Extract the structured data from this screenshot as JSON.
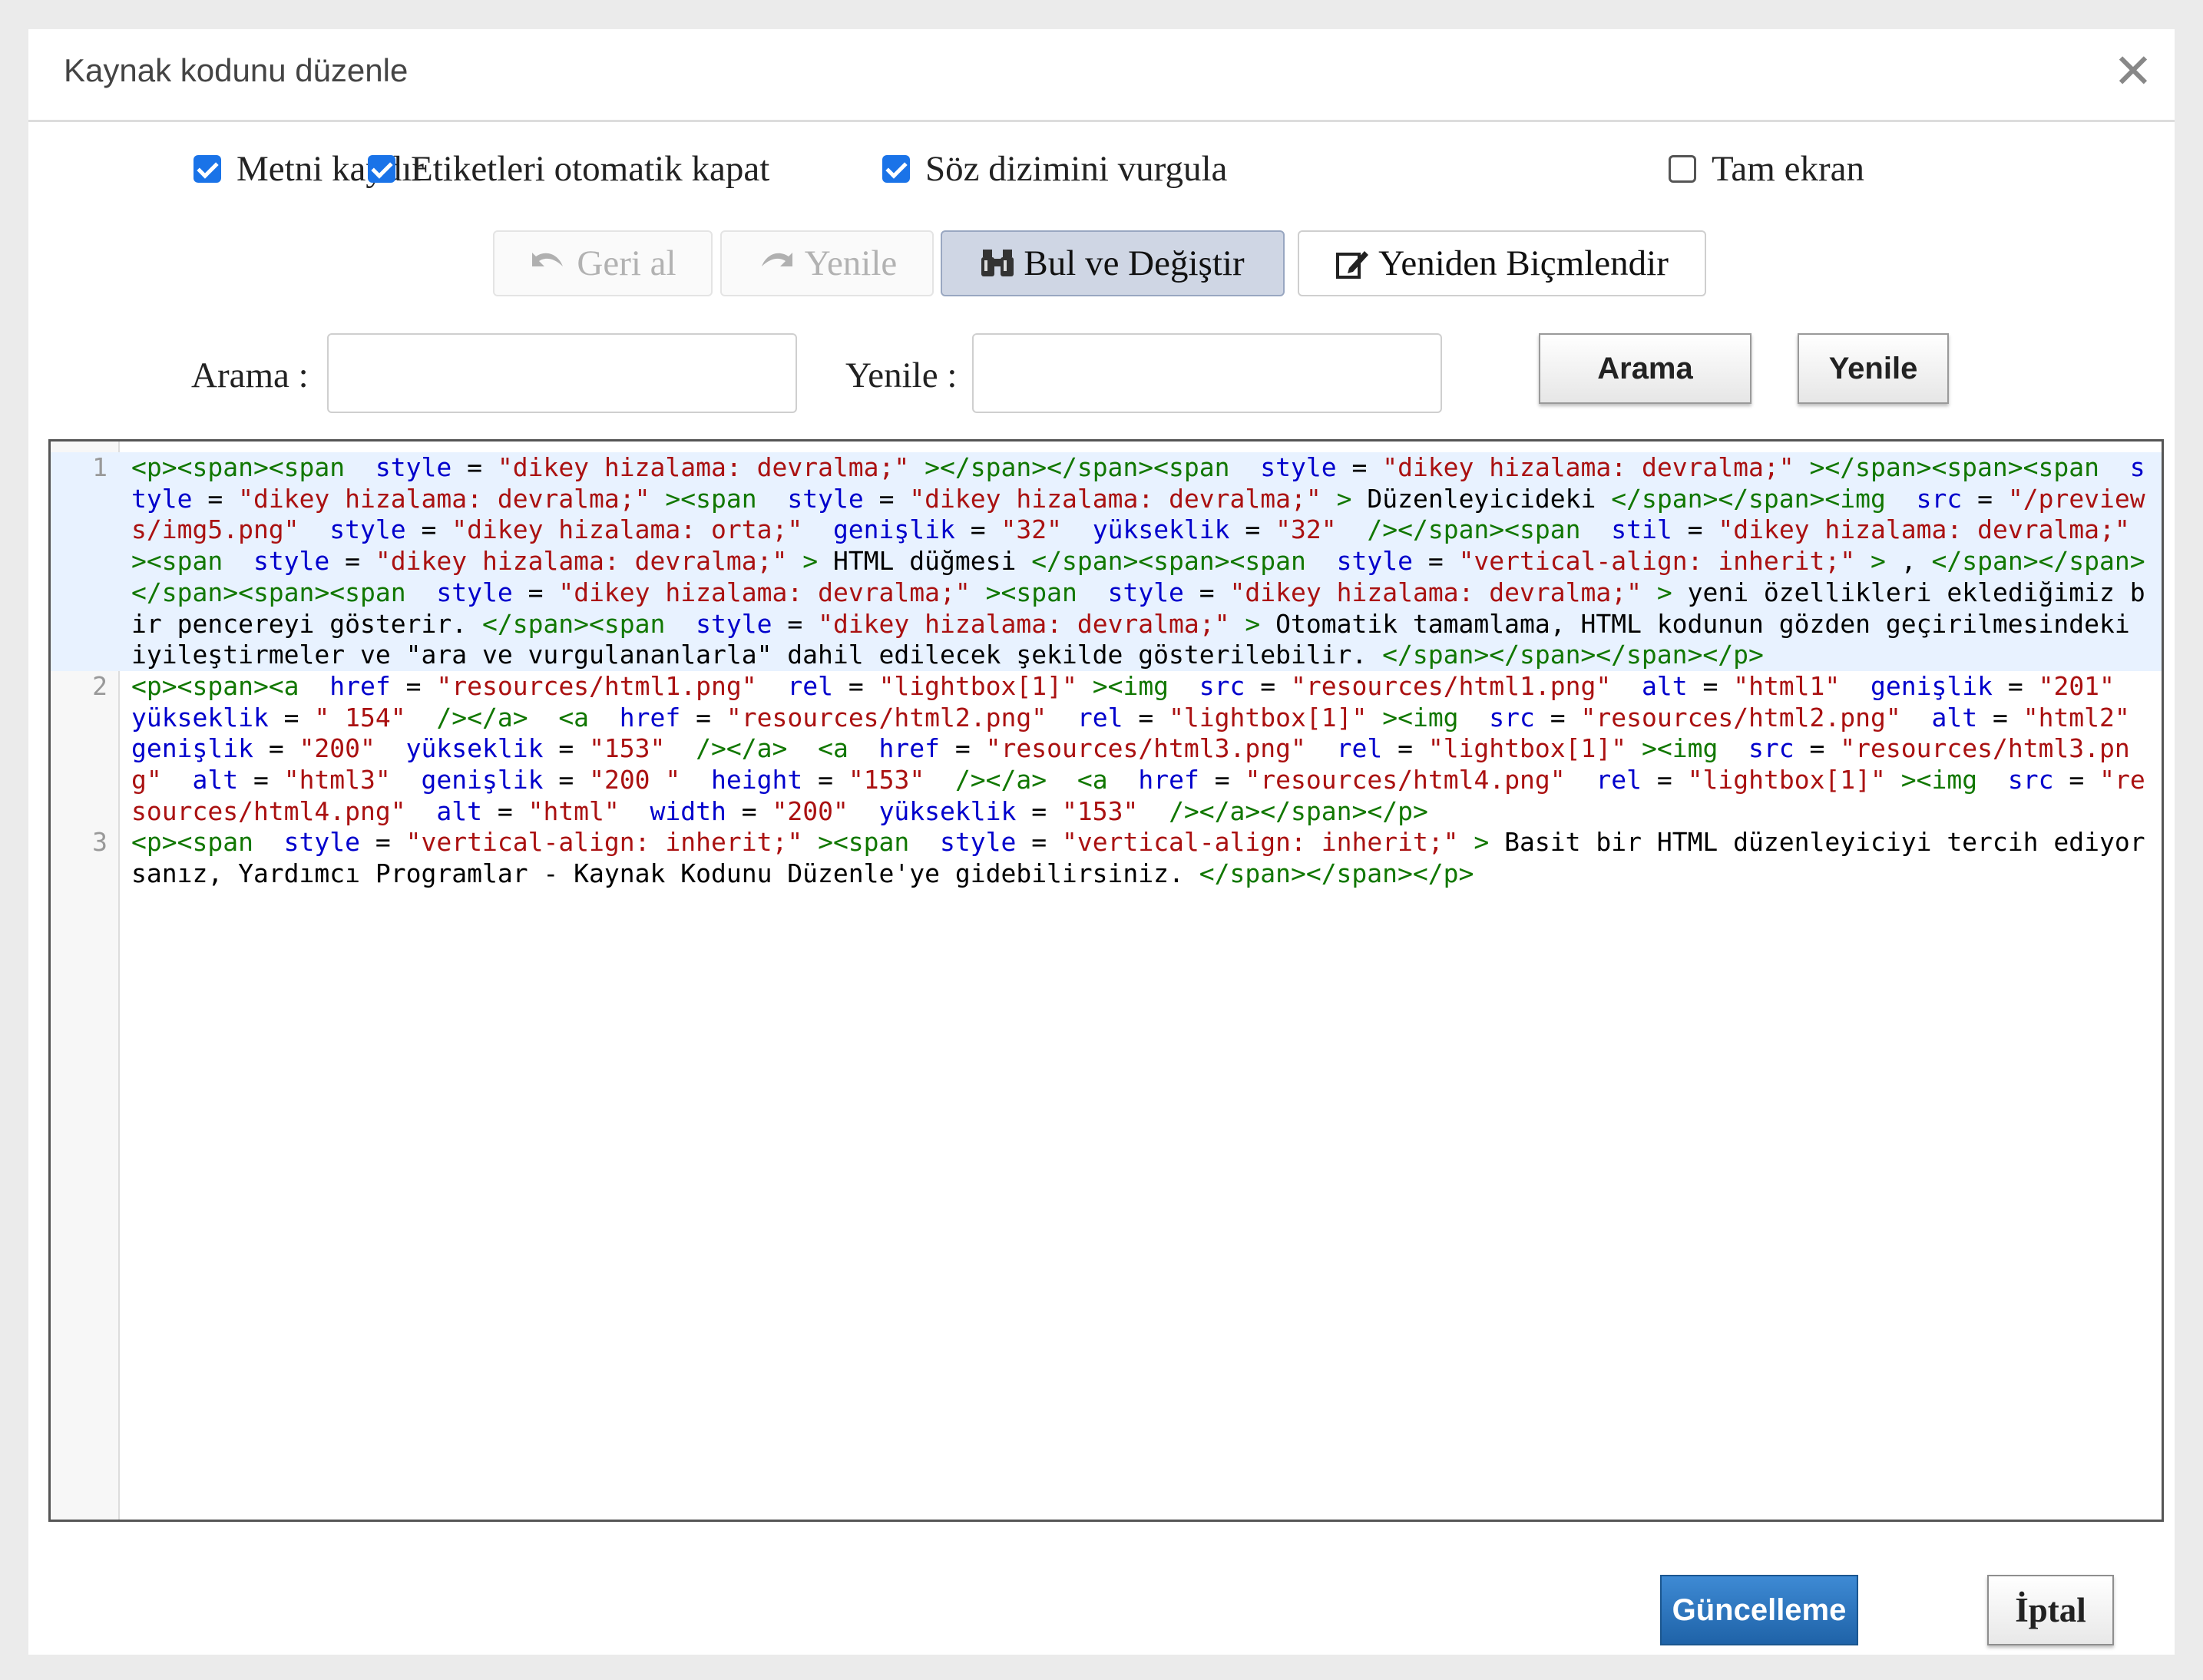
{
  "dialog": {
    "title": "Kaynak kodunu düzenle",
    "close_glyph": "✕"
  },
  "options": [
    {
      "label": "Metni kaydır",
      "checked": true
    },
    {
      "label": "Etiketleri otomatik kapat",
      "checked": true
    },
    {
      "label": "Söz dizimini vurgula",
      "checked": true
    },
    {
      "label": "Tam ekran",
      "checked": false
    }
  ],
  "toolbar": {
    "undo_label": "Geri al",
    "redo_label": "Yenile",
    "find_replace_label": "Bul ve Değiştir",
    "reformat_label": "Yeniden Biçmlendir"
  },
  "search": {
    "search_label": "Arama :",
    "replace_label": "Yenile :",
    "search_value": "",
    "replace_value": "",
    "search_button": "Arama",
    "replace_button": "Yenile"
  },
  "editor": {
    "lines": [
      {
        "number": "1",
        "selected": true,
        "tokens": [
          {
            "k": "t",
            "v": "<p><span><span "
          },
          {
            "k": "a",
            "v": " style"
          },
          {
            "k": "x",
            "v": " = "
          },
          {
            "k": "s",
            "v": "\"dikey hizalama: devralma;\""
          },
          {
            "k": "t",
            "v": " ></span></span><span "
          },
          {
            "k": "a",
            "v": " style"
          },
          {
            "k": "x",
            "v": " = "
          },
          {
            "k": "s",
            "v": "\"dikey hizalama: devralma;\""
          },
          {
            "k": "t",
            "v": " ></span><span><span "
          },
          {
            "k": "a",
            "v": " style"
          },
          {
            "k": "x",
            "v": " = "
          },
          {
            "k": "s",
            "v": "\"dikey hizalama: devralma;\""
          },
          {
            "k": "t",
            "v": " ><span "
          },
          {
            "k": "a",
            "v": " style"
          },
          {
            "k": "x",
            "v": " = "
          },
          {
            "k": "s",
            "v": "\"dikey hizalama: devralma;\""
          },
          {
            "k": "t",
            "v": " > "
          },
          {
            "k": "x",
            "v": "Düzenleyicideki "
          },
          {
            "k": "t",
            "v": "</span></span><img "
          },
          {
            "k": "a",
            "v": " src"
          },
          {
            "k": "x",
            "v": " = "
          },
          {
            "k": "s",
            "v": "\"/previews/img5.png\""
          },
          {
            "k": "a",
            "v": "  style"
          },
          {
            "k": "x",
            "v": " = "
          },
          {
            "k": "s",
            "v": "\"dikey hizalama: orta;\""
          },
          {
            "k": "a",
            "v": "  genişlik"
          },
          {
            "k": "x",
            "v": " = "
          },
          {
            "k": "s",
            "v": "\"32\""
          },
          {
            "k": "a",
            "v": "  yükseklik"
          },
          {
            "k": "x",
            "v": " = "
          },
          {
            "k": "s",
            "v": "\"32\""
          },
          {
            "k": "t",
            "v": "  /></span><span "
          },
          {
            "k": "a",
            "v": " stil"
          },
          {
            "k": "x",
            "v": " = "
          },
          {
            "k": "s",
            "v": "\"dikey hizalama: devralma;\""
          },
          {
            "k": "t",
            "v": " ><span "
          },
          {
            "k": "a",
            "v": " style"
          },
          {
            "k": "x",
            "v": " = "
          },
          {
            "k": "s",
            "v": "\"dikey hizalama: devralma;\""
          },
          {
            "k": "t",
            "v": " > "
          },
          {
            "k": "x",
            "v": "HTML düğmesi "
          },
          {
            "k": "t",
            "v": "</span><span><span "
          },
          {
            "k": "a",
            "v": " style"
          },
          {
            "k": "x",
            "v": " = "
          },
          {
            "k": "s",
            "v": "\"vertical-align: inherit;\""
          },
          {
            "k": "t",
            "v": " > "
          },
          {
            "k": "x",
            "v": ", "
          },
          {
            "k": "t",
            "v": "</span></span></span><span><span "
          },
          {
            "k": "a",
            "v": " style"
          },
          {
            "k": "x",
            "v": " = "
          },
          {
            "k": "s",
            "v": "\"dikey hizalama: devralma;\""
          },
          {
            "k": "t",
            "v": " ><span "
          },
          {
            "k": "a",
            "v": " style"
          },
          {
            "k": "x",
            "v": " = "
          },
          {
            "k": "s",
            "v": "\"dikey hizalama: devralma;\""
          },
          {
            "k": "t",
            "v": " > "
          },
          {
            "k": "x",
            "v": "yeni özellikleri eklediğimiz bir pencereyi gösterir. "
          },
          {
            "k": "t",
            "v": "</span><span "
          },
          {
            "k": "a",
            "v": " style"
          },
          {
            "k": "x",
            "v": " = "
          },
          {
            "k": "s",
            "v": "\"dikey hizalama: devralma;\""
          },
          {
            "k": "t",
            "v": " > "
          },
          {
            "k": "x",
            "v": "Otomatik tamamlama, HTML kodunun gözden geçirilmesindeki iyileştirmeler ve \"ara ve vurgulananlarla\" dahil edilecek şekilde gösterilebilir. "
          },
          {
            "k": "t",
            "v": "</span></span></span></p>"
          }
        ]
      },
      {
        "number": "2",
        "selected": false,
        "tokens": [
          {
            "k": "t",
            "v": "<p><span><a "
          },
          {
            "k": "a",
            "v": " href"
          },
          {
            "k": "x",
            "v": " = "
          },
          {
            "k": "s",
            "v": "\"resources/html1.png\""
          },
          {
            "k": "a",
            "v": "  rel"
          },
          {
            "k": "x",
            "v": " = "
          },
          {
            "k": "s",
            "v": "\"lightbox[1]\""
          },
          {
            "k": "t",
            "v": " ><img "
          },
          {
            "k": "a",
            "v": " src"
          },
          {
            "k": "x",
            "v": " = "
          },
          {
            "k": "s",
            "v": "\"resources/html1.png\""
          },
          {
            "k": "a",
            "v": "  alt"
          },
          {
            "k": "x",
            "v": " = "
          },
          {
            "k": "s",
            "v": "\"html1\""
          },
          {
            "k": "a",
            "v": "  genişlik"
          },
          {
            "k": "x",
            "v": " = "
          },
          {
            "k": "s",
            "v": "\"201\""
          },
          {
            "k": "a",
            "v": "  yükseklik"
          },
          {
            "k": "x",
            "v": " = "
          },
          {
            "k": "s",
            "v": "\" 154\""
          },
          {
            "k": "t",
            "v": "  /></a>  <a "
          },
          {
            "k": "a",
            "v": " href"
          },
          {
            "k": "x",
            "v": " = "
          },
          {
            "k": "s",
            "v": "\"resources/html2.png\""
          },
          {
            "k": "a",
            "v": "  rel"
          },
          {
            "k": "x",
            "v": " = "
          },
          {
            "k": "s",
            "v": "\"lightbox[1]\""
          },
          {
            "k": "t",
            "v": " ><img "
          },
          {
            "k": "a",
            "v": " src"
          },
          {
            "k": "x",
            "v": " = "
          },
          {
            "k": "s",
            "v": "\"resources/html2.png\""
          },
          {
            "k": "a",
            "v": "  alt"
          },
          {
            "k": "x",
            "v": " = "
          },
          {
            "k": "s",
            "v": "\"html2\""
          },
          {
            "k": "a",
            "v": "  genişlik"
          },
          {
            "k": "x",
            "v": " = "
          },
          {
            "k": "s",
            "v": "\"200\""
          },
          {
            "k": "a",
            "v": "  yükseklik"
          },
          {
            "k": "x",
            "v": " = "
          },
          {
            "k": "s",
            "v": "\"153\""
          },
          {
            "k": "t",
            "v": "  /></a>  <a "
          },
          {
            "k": "a",
            "v": " href"
          },
          {
            "k": "x",
            "v": " = "
          },
          {
            "k": "s",
            "v": "\"resources/html3.png\""
          },
          {
            "k": "a",
            "v": "  rel"
          },
          {
            "k": "x",
            "v": " = "
          },
          {
            "k": "s",
            "v": "\"lightbox[1]\""
          },
          {
            "k": "t",
            "v": " ><img "
          },
          {
            "k": "a",
            "v": " src"
          },
          {
            "k": "x",
            "v": " = "
          },
          {
            "k": "s",
            "v": "\"resources/html3.png\""
          },
          {
            "k": "a",
            "v": "  alt"
          },
          {
            "k": "x",
            "v": " = "
          },
          {
            "k": "s",
            "v": "\"html3\""
          },
          {
            "k": "a",
            "v": "  genişlik"
          },
          {
            "k": "x",
            "v": " = "
          },
          {
            "k": "s",
            "v": "\"200 \""
          },
          {
            "k": "a",
            "v": "  height"
          },
          {
            "k": "x",
            "v": " = "
          },
          {
            "k": "s",
            "v": "\"153\""
          },
          {
            "k": "t",
            "v": "  /></a>  <a "
          },
          {
            "k": "a",
            "v": " href"
          },
          {
            "k": "x",
            "v": " = "
          },
          {
            "k": "s",
            "v": "\"resources/html4.png\""
          },
          {
            "k": "a",
            "v": "  rel"
          },
          {
            "k": "x",
            "v": " = "
          },
          {
            "k": "s",
            "v": "\"lightbox[1]\""
          },
          {
            "k": "t",
            "v": " ><img "
          },
          {
            "k": "a",
            "v": " src"
          },
          {
            "k": "x",
            "v": " = "
          },
          {
            "k": "s",
            "v": "\"resources/html4.png\""
          },
          {
            "k": "a",
            "v": "  alt"
          },
          {
            "k": "x",
            "v": " = "
          },
          {
            "k": "s",
            "v": "\"html\""
          },
          {
            "k": "a",
            "v": "  width"
          },
          {
            "k": "x",
            "v": " = "
          },
          {
            "k": "s",
            "v": "\"200\""
          },
          {
            "k": "a",
            "v": "  yükseklik"
          },
          {
            "k": "x",
            "v": " = "
          },
          {
            "k": "s",
            "v": "\"153\""
          },
          {
            "k": "t",
            "v": "  /></a></span></p>"
          }
        ]
      },
      {
        "number": "3",
        "selected": false,
        "tokens": [
          {
            "k": "t",
            "v": "<p><span "
          },
          {
            "k": "a",
            "v": " style"
          },
          {
            "k": "x",
            "v": " = "
          },
          {
            "k": "s",
            "v": "\"vertical-align: inherit;\""
          },
          {
            "k": "t",
            "v": " ><span "
          },
          {
            "k": "a",
            "v": " style"
          },
          {
            "k": "x",
            "v": " = "
          },
          {
            "k": "s",
            "v": "\"vertical-align: inherit;\""
          },
          {
            "k": "t",
            "v": " > "
          },
          {
            "k": "x",
            "v": "Basit bir HTML düzenleyiciyi tercih ediyorsanız, Yardımcı Programlar - Kaynak Kodunu Düzenle'ye gidebilirsiniz. "
          },
          {
            "k": "t",
            "v": "</span></span></p>"
          }
        ]
      }
    ]
  },
  "footer": {
    "update_button": "Güncelleme",
    "cancel_button": "İptal"
  },
  "colors": {
    "tag": "#117700",
    "attribute": "#0000cc",
    "string": "#aa1111",
    "primary_button": "#2a71bb",
    "checkbox": "#1a73e8"
  }
}
